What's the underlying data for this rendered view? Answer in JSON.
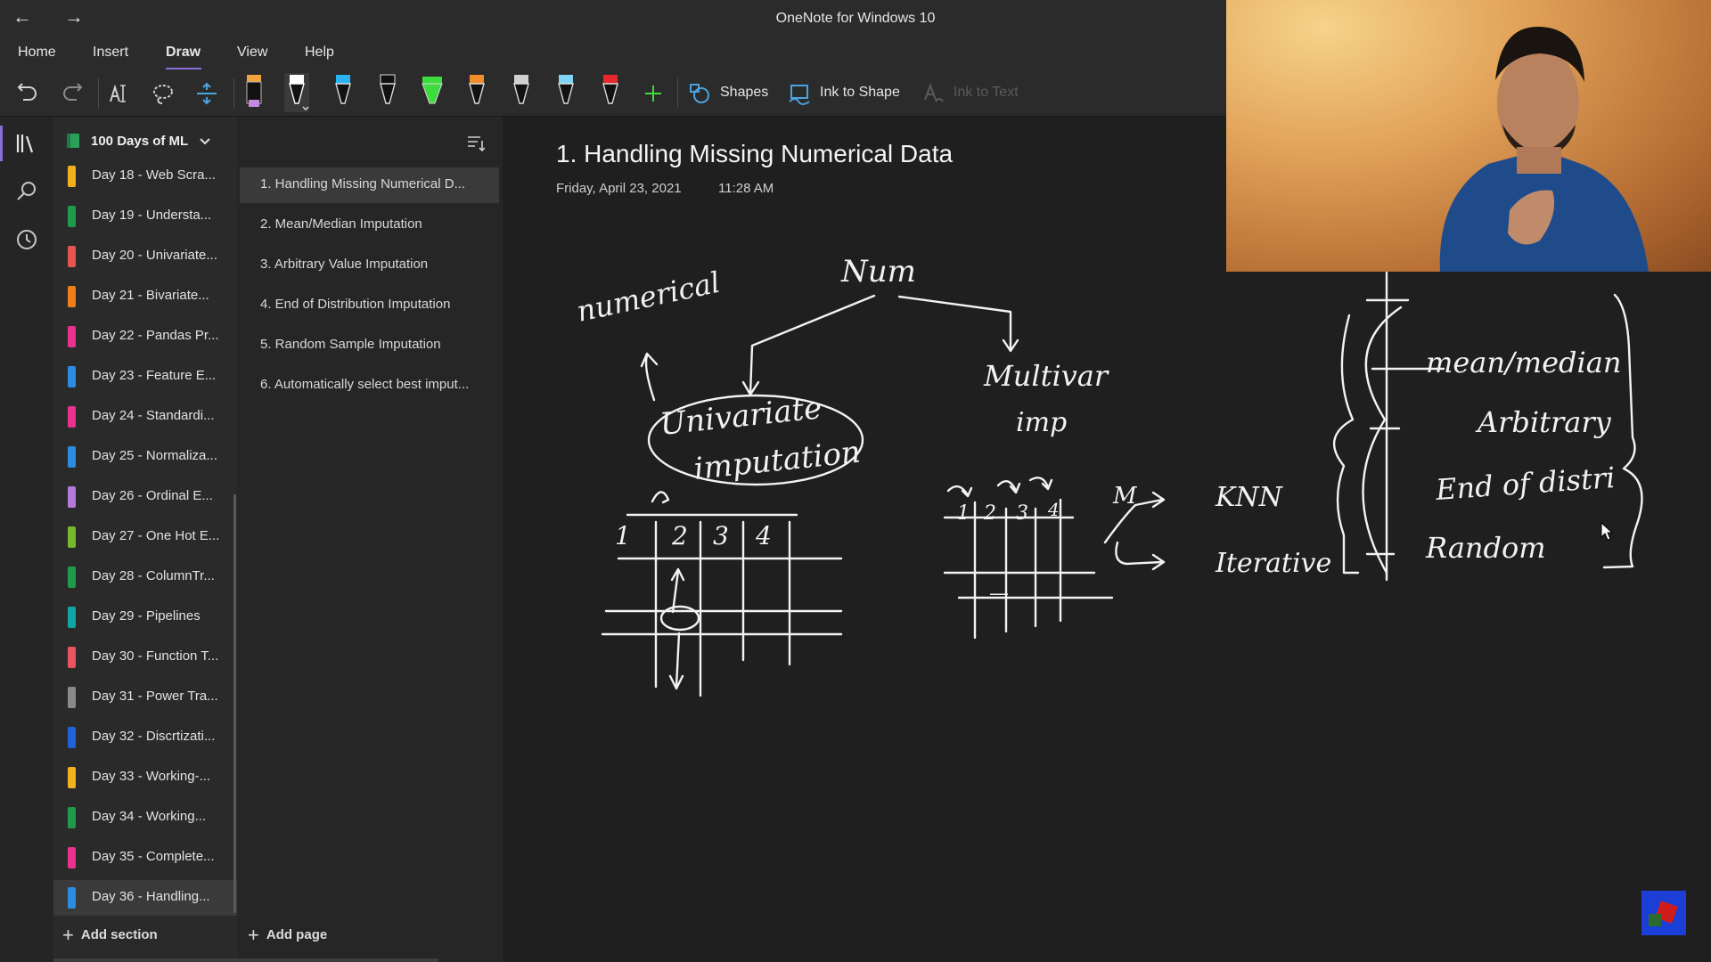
{
  "app": {
    "title": "OneNote for Windows 10"
  },
  "menu": {
    "items": [
      "Home",
      "Insert",
      "Draw",
      "View",
      "Help"
    ],
    "active": "Draw"
  },
  "toolbar": {
    "shapes_label": "Shapes",
    "ink_to_shape_label": "Ink to Shape",
    "ink_to_text_label": "Ink to Text",
    "pens": [
      {
        "name": "highlighter-orange",
        "color": "#f2a33a"
      },
      {
        "name": "pen-white",
        "color": "#ffffff"
      },
      {
        "name": "pen-blue",
        "color": "#2ab3f0"
      },
      {
        "name": "pen-black",
        "color": "#ffffff"
      },
      {
        "name": "highlighter-green",
        "color": "#3ddc3d"
      },
      {
        "name": "pen-orange",
        "color": "#f28c28"
      },
      {
        "name": "pen-gray",
        "color": "#d0d0d0"
      },
      {
        "name": "pen-lightblue",
        "color": "#7fd4f5"
      },
      {
        "name": "pen-red",
        "color": "#e8282a"
      }
    ]
  },
  "notebook": {
    "title": "100 Days of ML",
    "sections": [
      {
        "label": "Day 18 - Web Scra...",
        "color": "#f2b01e"
      },
      {
        "label": "Day 19 - Understa...",
        "color": "#1f9a4a"
      },
      {
        "label": "Day 20 - Univariate...",
        "color": "#e8544f"
      },
      {
        "label": "Day 21 - Bivariate...",
        "color": "#f07d1a"
      },
      {
        "label": "Day 22 - Pandas Pr...",
        "color": "#e9328d"
      },
      {
        "label": "Day 23 - Feature E...",
        "color": "#2b8de0"
      },
      {
        "label": "Day 24 - Standardi...",
        "color": "#e9328d"
      },
      {
        "label": "Day 25 - Normaliza...",
        "color": "#2b8de0"
      },
      {
        "label": "Day 26 - Ordinal E...",
        "color": "#b57ad9"
      },
      {
        "label": "Day 27 - One Hot E...",
        "color": "#76b82a"
      },
      {
        "label": "Day 28 - ColumnTr...",
        "color": "#1f9a4a"
      },
      {
        "label": "Day 29 - Pipelines",
        "color": "#12a5a5"
      },
      {
        "label": "Day 30 - Function T...",
        "color": "#e8545f"
      },
      {
        "label": "Day 31 - Power Tra...",
        "color": "#8a8a8a"
      },
      {
        "label": "Day 32 - Discrtizati...",
        "color": "#2063d6"
      },
      {
        "label": "Day 33 - Working-...",
        "color": "#f2b01e"
      },
      {
        "label": "Day 34 - Working...",
        "color": "#1f9a4a"
      },
      {
        "label": "Day 35 - Complete...",
        "color": "#e9328d"
      },
      {
        "label": "Day 36 - Handling...",
        "color": "#2b8de0"
      }
    ],
    "selected_section": 18,
    "add_section_label": "Add section"
  },
  "pages": {
    "items": [
      "1. Handling Missing Numerical D...",
      "2. Mean/Median Imputation",
      "3. Arbitrary Value Imputation",
      "4. End of Distribution Imputation",
      "5. Random Sample Imputation",
      "6. Automatically select best imput..."
    ],
    "selected": 0,
    "add_page_label": "Add page"
  },
  "page": {
    "title": "1. Handling Missing Numerical Data",
    "date": "Friday, April 23, 2021",
    "time": "11:28 AM"
  },
  "ink_text": {
    "numerical": "numerical",
    "num": "Num",
    "univariate": "Univariate",
    "imputation": "imputation",
    "multivar": "Multivar",
    "imp": "imp",
    "m": "M",
    "knn": "KNN",
    "iterative": "Iterative",
    "mean_median": "mean/median",
    "arbitrary": "Arbitrary",
    "end_of_distri": "End of distri",
    "random": "Random",
    "col1": "1",
    "col2": "2",
    "col3": "3",
    "col4": "4",
    "dash": "—"
  }
}
